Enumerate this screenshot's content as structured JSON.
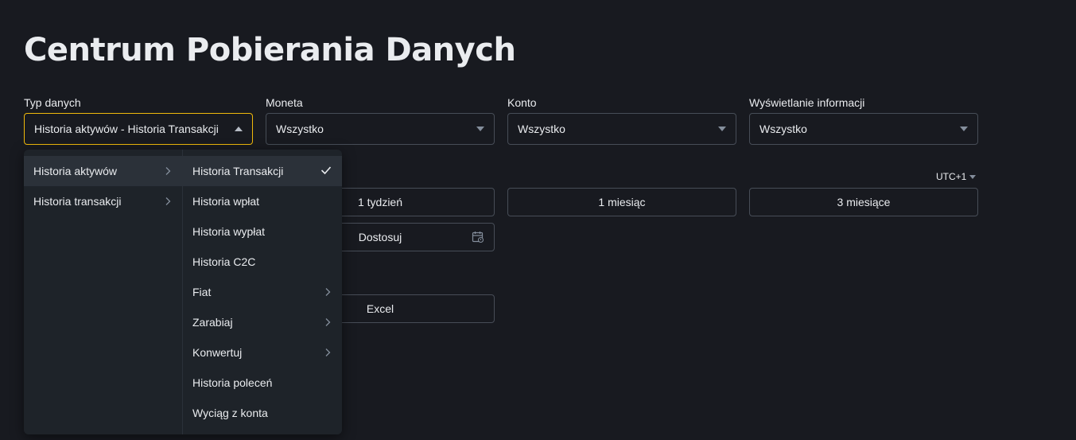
{
  "page": {
    "title": "Centrum Pobierania Danych"
  },
  "filters": [
    {
      "label": "Typ danych",
      "value": "Historia aktywów - Historia Transakcji"
    },
    {
      "label": "Moneta",
      "value": "Wszystko"
    },
    {
      "label": "Konto",
      "value": "Wszystko"
    },
    {
      "label": "Wyświetlanie informacji",
      "value": "Wszystko"
    }
  ],
  "timezone": "UTC+1",
  "ranges": {
    "week": "1 tydzień",
    "month": "1 miesiąc",
    "three_months": "3 miesiące",
    "custom": "Dostosuj"
  },
  "format": {
    "excel": "Excel"
  },
  "dropdown": {
    "left": [
      {
        "label": "Historia aktywów"
      },
      {
        "label": "Historia transakcji"
      }
    ],
    "right": [
      {
        "label": "Historia Transakcji"
      },
      {
        "label": "Historia wpłat"
      },
      {
        "label": "Historia wypłat"
      },
      {
        "label": "Historia C2C"
      },
      {
        "label": "Fiat"
      },
      {
        "label": "Zarabiaj"
      },
      {
        "label": "Konwertuj"
      },
      {
        "label": "Historia poleceń"
      },
      {
        "label": "Wyciąg z konta"
      }
    ]
  },
  "colors": {
    "accent": "#f0b90b",
    "background": "#181a20",
    "panel": "#1e2329"
  }
}
